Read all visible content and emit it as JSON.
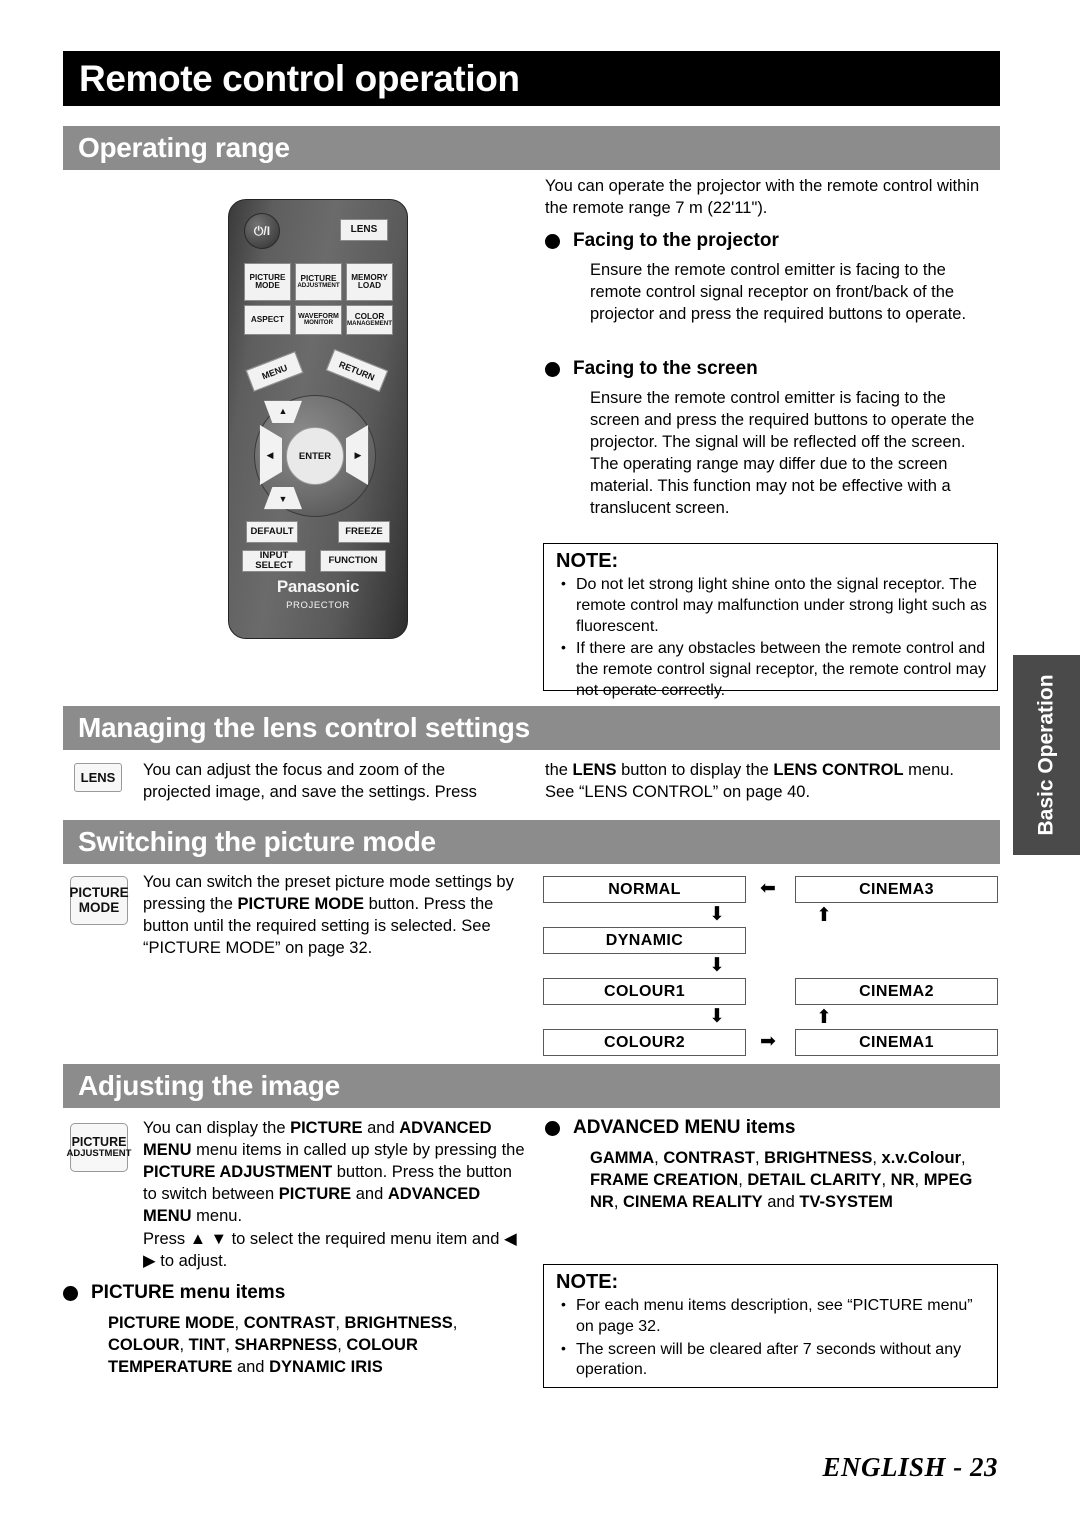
{
  "page": {
    "title": "Remote control operation",
    "footer_label": "ENGLISH - 23",
    "side_tab": "Basic Operation"
  },
  "sections": {
    "operating_range": {
      "heading": "Operating range",
      "intro": "You can operate the projector with the remote control within the remote range 7 m (22'11\").",
      "facing_projector": {
        "heading": "Facing to the projector",
        "body": "Ensure the remote control emitter is facing to the remote control signal receptor on front/back of the projector and press the required buttons to operate."
      },
      "facing_screen": {
        "heading": "Facing to the screen",
        "body": "Ensure the remote control emitter is facing to the screen and press the required buttons to operate the projector. The signal will be reflected off the screen. The operating range may differ due to the screen material. This function may not be effective with a translucent screen."
      },
      "note": {
        "title": "NOTE:",
        "items": [
          "Do not let strong light shine onto the signal receptor. The remote control may malfunction under strong light such as fluorescent.",
          "If there are any obstacles between the remote control and the remote control signal receptor, the remote control may not operate correctly."
        ]
      }
    },
    "lens_control": {
      "heading": "Managing the lens control settings",
      "key_icon_label": "LENS",
      "body_col1_a": "You can adjust the focus and zoom of the",
      "body_col1_b": "projected image, and save the settings. Press",
      "body_col2_a_pre": "the ",
      "body_col2_a_b1": "LENS",
      "body_col2_a_mid": " button to display the ",
      "body_col2_a_b2": "LENS CONTROL",
      "body_col2_a_post": " menu.",
      "body_col2_b": "See “LENS CONTROL” on page 40."
    },
    "picture_mode": {
      "heading": "Switching the picture mode",
      "key_icon_line1": "PICTURE",
      "key_icon_line2": "MODE",
      "body_pre": "You can switch the preset picture mode settings by pressing the ",
      "body_bold": "PICTURE MODE",
      "body_post": " button. Press the button until the required setting is selected. See “PICTURE MODE” on page 32.",
      "flow": {
        "left_column": [
          "NORMAL",
          "DYNAMIC",
          "COLOUR1",
          "COLOUR2"
        ],
        "right_column": [
          "CINEMA3",
          "CINEMA2",
          "CINEMA1"
        ],
        "arrows": [
          "down",
          "down",
          "down",
          "right",
          "up",
          "up",
          "left"
        ]
      }
    },
    "adjusting_image": {
      "heading": "Adjusting the image",
      "key_icon_line1": "PICTURE",
      "key_icon_line2": "ADJUSTMENT",
      "body_p1_a": "You can display the ",
      "body_p1_b1": "PICTURE",
      "body_p1_b": " and ",
      "body_p1_b2": "ADVANCED MENU",
      "body_p1_c": " menu items in called up style by pressing the ",
      "body_p1_b3": "PICTURE ADJUSTMENT",
      "body_p1_d": " button. Press the button to switch between ",
      "body_p1_b4": "PICTURE",
      "body_p1_e": " and ",
      "body_p1_b5": "ADVANCED MENU",
      "body_p1_f": " menu.",
      "body_p2": "Press ▲ ▼ to select the required menu item and ◀ ▶ to adjust.",
      "picture_menu": {
        "heading": "PICTURE menu items",
        "items_b1": "PICTURE MODE",
        "sep1": ", ",
        "items_b2": "CONTRAST",
        "sep2": ", ",
        "items_b3": "BRIGHTNESS",
        "sep3": ", ",
        "items_b4": "COLOUR",
        "sep4": ", ",
        "items_b5": "TINT",
        "sep5": ", ",
        "items_b6": "SHARPNESS",
        "sep6": ", ",
        "items_b7": "COLOUR TEMPERATURE",
        "joiner": " and ",
        "items_b8": "DYNAMIC IRIS"
      },
      "advanced_menu": {
        "heading": "ADVANCED MENU items",
        "items_b1": "GAMMA",
        "sep1": ", ",
        "items_b2": "CONTRAST",
        "sep2": ", ",
        "items_b3": "BRIGHTNESS",
        "sep3": ", ",
        "items_b4": "x.v.Colour",
        "sep4": ", ",
        "items_b5": "FRAME CREATION",
        "sep5": ", ",
        "items_b6": "DETAIL CLARITY",
        "sep6": ", ",
        "items_b7": "NR",
        "sep7": ", ",
        "items_b8": "MPEG NR",
        "sep8": ", ",
        "items_b9": "CINEMA REALITY",
        "joiner": " and ",
        "items_b10": "TV-SYSTEM"
      },
      "note": {
        "title": "NOTE:",
        "items": [
          "For each menu items description, see “PICTURE menu” on page 32.",
          "The screen will be cleared after 7 seconds without any operation."
        ]
      }
    }
  },
  "remote": {
    "power_label": "⏻/I",
    "lens": "LENS",
    "picture_mode_l1": "PICTURE",
    "picture_mode_l2": "MODE",
    "picture_adjustment_l1": "PICTURE",
    "picture_adjustment_l2": "ADJUSTMENT",
    "memory_load_l1": "MEMORY",
    "memory_load_l2": "LOAD",
    "aspect": "ASPECT",
    "waveform_l1": "WAVEFORM",
    "waveform_l2": "MONITOR",
    "color_l1": "COLOR",
    "color_l2": "MANAGEMENT",
    "menu": "MENU",
    "return": "RETURN",
    "enter": "ENTER",
    "up": "▲",
    "down": "▼",
    "left": "◀",
    "right": "▶",
    "default": "DEFAULT",
    "freeze": "FREEZE",
    "input_select": "INPUT SELECT",
    "function": "FUNCTION",
    "brand": "Panasonic",
    "brand_sub": "PROJECTOR"
  }
}
